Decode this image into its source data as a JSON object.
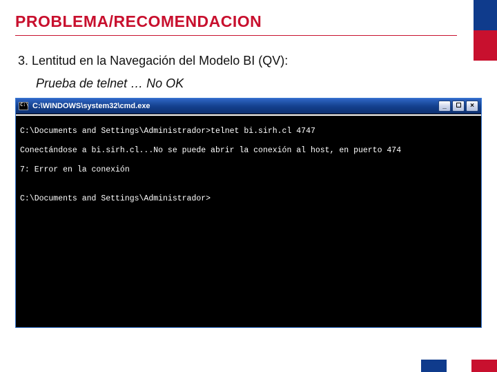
{
  "slide": {
    "title": "PROBLEMA/RECOMENDACION",
    "subtitle1": "3. Lentitud en la Navegación del Modelo BI (QV):",
    "subtitle2": "Prueba de telnet … No OK"
  },
  "cmd": {
    "window_title": "C:\\WINDOWS\\system32\\cmd.exe",
    "lines": [
      "C:\\Documents and Settings\\Administrador>telnet bi.sirh.cl 4747",
      "Conectándose a bi.sirh.cl...No se puede abrir la conexión al host, en puerto 474",
      "7: Error en la conexión",
      "",
      "C:\\Documents and Settings\\Administrador>"
    ],
    "btn_min": "_",
    "btn_close": "×"
  }
}
